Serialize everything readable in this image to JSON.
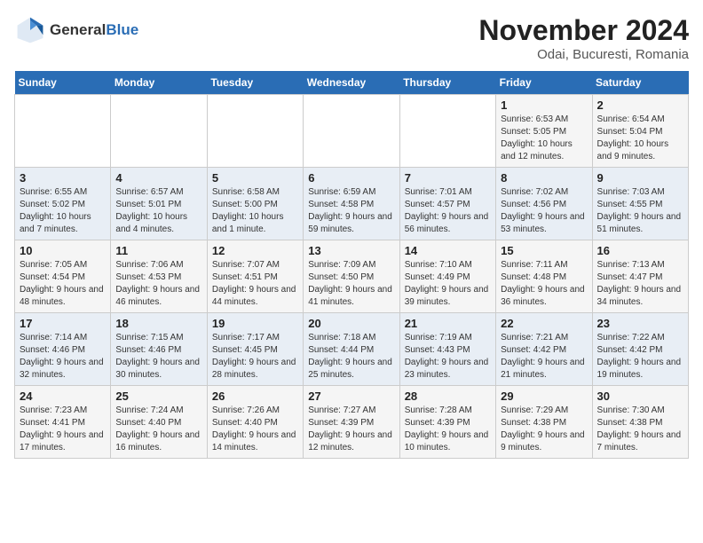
{
  "header": {
    "logo_general": "General",
    "logo_blue": "Blue",
    "month": "November 2024",
    "location": "Odai, Bucuresti, Romania"
  },
  "weekdays": [
    "Sunday",
    "Monday",
    "Tuesday",
    "Wednesday",
    "Thursday",
    "Friday",
    "Saturday"
  ],
  "weeks": [
    [
      {
        "day": "",
        "info": ""
      },
      {
        "day": "",
        "info": ""
      },
      {
        "day": "",
        "info": ""
      },
      {
        "day": "",
        "info": ""
      },
      {
        "day": "",
        "info": ""
      },
      {
        "day": "1",
        "info": "Sunrise: 6:53 AM\nSunset: 5:05 PM\nDaylight: 10 hours and 12 minutes."
      },
      {
        "day": "2",
        "info": "Sunrise: 6:54 AM\nSunset: 5:04 PM\nDaylight: 10 hours and 9 minutes."
      }
    ],
    [
      {
        "day": "3",
        "info": "Sunrise: 6:55 AM\nSunset: 5:02 PM\nDaylight: 10 hours and 7 minutes."
      },
      {
        "day": "4",
        "info": "Sunrise: 6:57 AM\nSunset: 5:01 PM\nDaylight: 10 hours and 4 minutes."
      },
      {
        "day": "5",
        "info": "Sunrise: 6:58 AM\nSunset: 5:00 PM\nDaylight: 10 hours and 1 minute."
      },
      {
        "day": "6",
        "info": "Sunrise: 6:59 AM\nSunset: 4:58 PM\nDaylight: 9 hours and 59 minutes."
      },
      {
        "day": "7",
        "info": "Sunrise: 7:01 AM\nSunset: 4:57 PM\nDaylight: 9 hours and 56 minutes."
      },
      {
        "day": "8",
        "info": "Sunrise: 7:02 AM\nSunset: 4:56 PM\nDaylight: 9 hours and 53 minutes."
      },
      {
        "day": "9",
        "info": "Sunrise: 7:03 AM\nSunset: 4:55 PM\nDaylight: 9 hours and 51 minutes."
      }
    ],
    [
      {
        "day": "10",
        "info": "Sunrise: 7:05 AM\nSunset: 4:54 PM\nDaylight: 9 hours and 48 minutes."
      },
      {
        "day": "11",
        "info": "Sunrise: 7:06 AM\nSunset: 4:53 PM\nDaylight: 9 hours and 46 minutes."
      },
      {
        "day": "12",
        "info": "Sunrise: 7:07 AM\nSunset: 4:51 PM\nDaylight: 9 hours and 44 minutes."
      },
      {
        "day": "13",
        "info": "Sunrise: 7:09 AM\nSunset: 4:50 PM\nDaylight: 9 hours and 41 minutes."
      },
      {
        "day": "14",
        "info": "Sunrise: 7:10 AM\nSunset: 4:49 PM\nDaylight: 9 hours and 39 minutes."
      },
      {
        "day": "15",
        "info": "Sunrise: 7:11 AM\nSunset: 4:48 PM\nDaylight: 9 hours and 36 minutes."
      },
      {
        "day": "16",
        "info": "Sunrise: 7:13 AM\nSunset: 4:47 PM\nDaylight: 9 hours and 34 minutes."
      }
    ],
    [
      {
        "day": "17",
        "info": "Sunrise: 7:14 AM\nSunset: 4:46 PM\nDaylight: 9 hours and 32 minutes."
      },
      {
        "day": "18",
        "info": "Sunrise: 7:15 AM\nSunset: 4:46 PM\nDaylight: 9 hours and 30 minutes."
      },
      {
        "day": "19",
        "info": "Sunrise: 7:17 AM\nSunset: 4:45 PM\nDaylight: 9 hours and 28 minutes."
      },
      {
        "day": "20",
        "info": "Sunrise: 7:18 AM\nSunset: 4:44 PM\nDaylight: 9 hours and 25 minutes."
      },
      {
        "day": "21",
        "info": "Sunrise: 7:19 AM\nSunset: 4:43 PM\nDaylight: 9 hours and 23 minutes."
      },
      {
        "day": "22",
        "info": "Sunrise: 7:21 AM\nSunset: 4:42 PM\nDaylight: 9 hours and 21 minutes."
      },
      {
        "day": "23",
        "info": "Sunrise: 7:22 AM\nSunset: 4:42 PM\nDaylight: 9 hours and 19 minutes."
      }
    ],
    [
      {
        "day": "24",
        "info": "Sunrise: 7:23 AM\nSunset: 4:41 PM\nDaylight: 9 hours and 17 minutes."
      },
      {
        "day": "25",
        "info": "Sunrise: 7:24 AM\nSunset: 4:40 PM\nDaylight: 9 hours and 16 minutes."
      },
      {
        "day": "26",
        "info": "Sunrise: 7:26 AM\nSunset: 4:40 PM\nDaylight: 9 hours and 14 minutes."
      },
      {
        "day": "27",
        "info": "Sunrise: 7:27 AM\nSunset: 4:39 PM\nDaylight: 9 hours and 12 minutes."
      },
      {
        "day": "28",
        "info": "Sunrise: 7:28 AM\nSunset: 4:39 PM\nDaylight: 9 hours and 10 minutes."
      },
      {
        "day": "29",
        "info": "Sunrise: 7:29 AM\nSunset: 4:38 PM\nDaylight: 9 hours and 9 minutes."
      },
      {
        "day": "30",
        "info": "Sunrise: 7:30 AM\nSunset: 4:38 PM\nDaylight: 9 hours and 7 minutes."
      }
    ]
  ]
}
